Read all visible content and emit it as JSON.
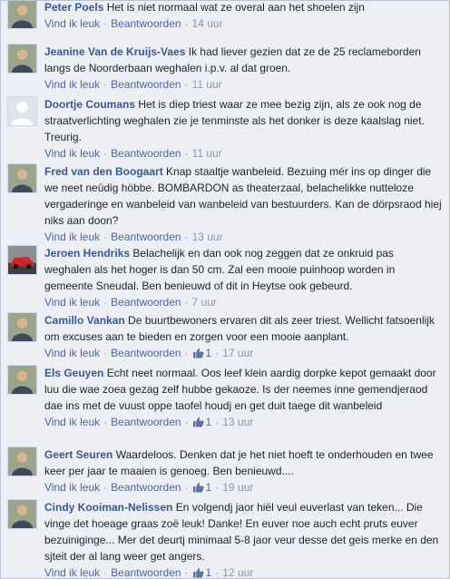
{
  "labels": {
    "like": "Vind ik leuk",
    "reply": "Beantwoorden",
    "dot": "·"
  },
  "colors": {
    "author": "#365899",
    "action": "#4b67a1",
    "meta": "#8c94a4",
    "bg": "#edeff4"
  },
  "comments": [
    {
      "author": "Peter Poels",
      "text": "Het is niet normaal wat ze overal aan het shoelen zijn",
      "likes": "",
      "time": "14 uur",
      "avatar_icon": "person-photo-icon"
    },
    {
      "author": "Jeanine Van de Kruijs-Vaes",
      "text": "Ik had liever gezien dat ze de 25 reclameborden langs de Noorderbaan weghalen i.p.v. al dat groen.",
      "likes": "",
      "time": "11 uur",
      "avatar_icon": "person-photo-icon"
    },
    {
      "author": "Doortje Coumans",
      "text": "Het is diep triest waar ze mee bezig zijn, als ze ook nog de straatverlichting weghalen zie je tenminste als het donker is deze kaalslag niet. Treurig.",
      "likes": "",
      "time": "11 uur",
      "avatar_icon": "default-avatar-icon"
    },
    {
      "author": "Fred van den Boogaart",
      "text": "Knap staaltje wanbeleid. Bezuing mér ins op dinger die we neet neûdig höbbe. BOMBARDON as theaterzaal, belachelikke nutteloze vergaderinge en wanbeleid van wanbeleid van bestuurders. Kan de dörpsraod hiej niks aan doon?",
      "likes": "",
      "time": "13 uur",
      "avatar_icon": "person-photo-icon"
    },
    {
      "author": "Jeroen Hendriks",
      "text": "Belachelijk en dan ook nog zeggen dat ze onkruid pas weghalen als het hoger is dan 50 cm. Zal een mooie puinhoop worden in gemeente Sneudal. Ben benieuwd of dit in Heytse ook gebeurd.",
      "likes": "",
      "time": "7 uur",
      "avatar_icon": "car-photo-icon"
    },
    {
      "author": "Camillo Vankan",
      "text": "De buurtbewoners ervaren dit als zeer triest. Wellicht fatsoenlijk om excuses aan te bieden en zorgen voor een mooie aanplant.",
      "likes": "1",
      "time": "17 uur",
      "avatar_icon": "person-photo-icon"
    },
    {
      "author": "Els Geuyen",
      "text": "Echt neet normaal. Oos leef klein aardig dorpke kepot gemaakt door luu die wae zoea gezag zelf hubbe gekaoze. Is der neemes inne gemendjeraod dae ins met de vuust oppe taofel houdj en get duit taege dit wanbeleid",
      "likes": "1",
      "time": "13 uur",
      "avatar_icon": "person-photo-icon"
    },
    {
      "author": "Geert Seuren",
      "text": "Waardeloos. Denken dat je het niet hoeft te onderhouden en twee keer per jaar te maaien is genoeg. Ben benieuwd....",
      "likes": "1",
      "time": "19 uur",
      "avatar_icon": "person-photo-icon"
    },
    {
      "author": "Cindy Kooiman-Nelissen",
      "text": "En volgendj jaor hiël veul euverlast van teken... Die vinge det hoeage graas zoë leuk! Danke! En euver noe auch echt pruts euver bezuiniginge... Mer det deurtj minimaal 5-8 jaor veur desse det geis merke en den sjteit der al lang weer get angers.",
      "likes": "1",
      "time": "12 uur",
      "avatar_icon": "person-photo-icon"
    }
  ]
}
